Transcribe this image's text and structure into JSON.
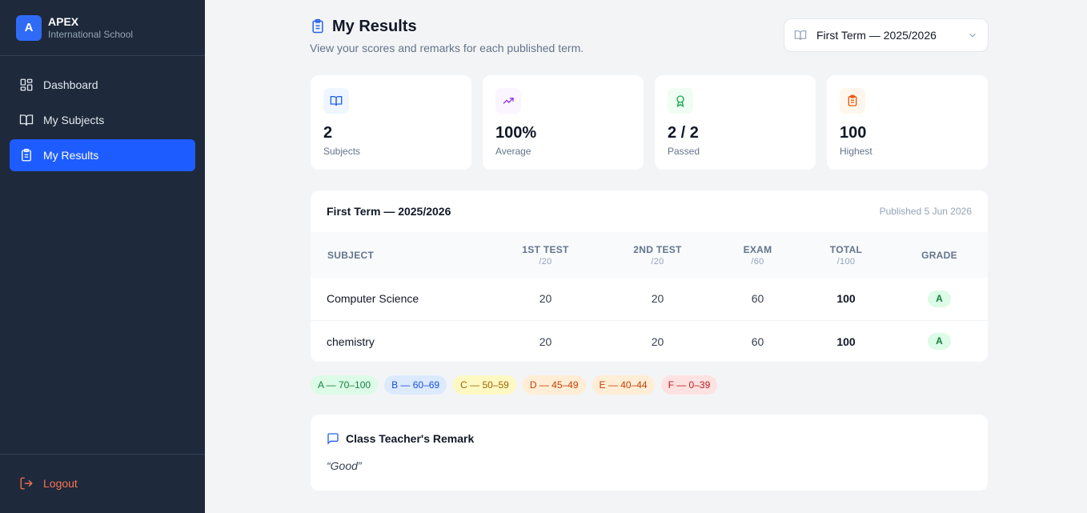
{
  "brand": {
    "logo_letter": "A",
    "name": "APEX",
    "subtitle": "International School"
  },
  "sidebar": {
    "items": [
      {
        "label": "Dashboard",
        "icon": "dashboard-icon",
        "active": false
      },
      {
        "label": "My Subjects",
        "icon": "book-open-icon",
        "active": false
      },
      {
        "label": "My Results",
        "icon": "clipboard-icon",
        "active": true
      }
    ],
    "logout_label": "Logout"
  },
  "header": {
    "title": "My Results",
    "subtitle": "View your scores and remarks for each published term.",
    "term_select_value": "First Term — 2025/2026"
  },
  "stats": [
    {
      "value": "2",
      "label": "Subjects",
      "icon": "book-open-icon",
      "color": "#2563eb",
      "bg": "#eff6ff"
    },
    {
      "value": "100%",
      "label": "Average",
      "icon": "trending-up-icon",
      "color": "#9333ea",
      "bg": "#faf5ff"
    },
    {
      "value": "2 / 2",
      "label": "Passed",
      "icon": "award-icon",
      "color": "#16a34a",
      "bg": "#f0fdf4"
    },
    {
      "value": "100",
      "label": "Highest",
      "icon": "clipboard-icon",
      "color": "#ea580c",
      "bg": "#fff7ed"
    }
  ],
  "results": {
    "term_title": "First Term — 2025/2026",
    "published": "Published 5 Jun 2026",
    "columns": [
      {
        "label": "Subject",
        "sub": ""
      },
      {
        "label": "1st Test",
        "sub": "/20"
      },
      {
        "label": "2nd Test",
        "sub": "/20"
      },
      {
        "label": "Exam",
        "sub": "/60"
      },
      {
        "label": "Total",
        "sub": "/100"
      },
      {
        "label": "Grade",
        "sub": ""
      }
    ],
    "rows": [
      {
        "subject": "Computer Science",
        "test1": "20",
        "test2": "20",
        "exam": "60",
        "total": "100",
        "grade": "A"
      },
      {
        "subject": "chemistry",
        "test1": "20",
        "test2": "20",
        "exam": "60",
        "total": "100",
        "grade": "A"
      }
    ]
  },
  "grade_legend": [
    {
      "label": "A — 70–100",
      "bg": "#dcfce7",
      "fg": "#15803d"
    },
    {
      "label": "B — 60–69",
      "bg": "#dbeafe",
      "fg": "#1d4ed8"
    },
    {
      "label": "C — 50–59",
      "bg": "#fef9c3",
      "fg": "#a16207"
    },
    {
      "label": "D — 45–49",
      "bg": "#ffedd5",
      "fg": "#c2410c"
    },
    {
      "label": "E — 40–44",
      "bg": "#ffedd5",
      "fg": "#c2410c"
    },
    {
      "label": "F — 0–39",
      "bg": "#fee2e2",
      "fg": "#b91c1c"
    }
  ],
  "remark": {
    "title": "Class Teacher's Remark",
    "text": "“Good”"
  }
}
